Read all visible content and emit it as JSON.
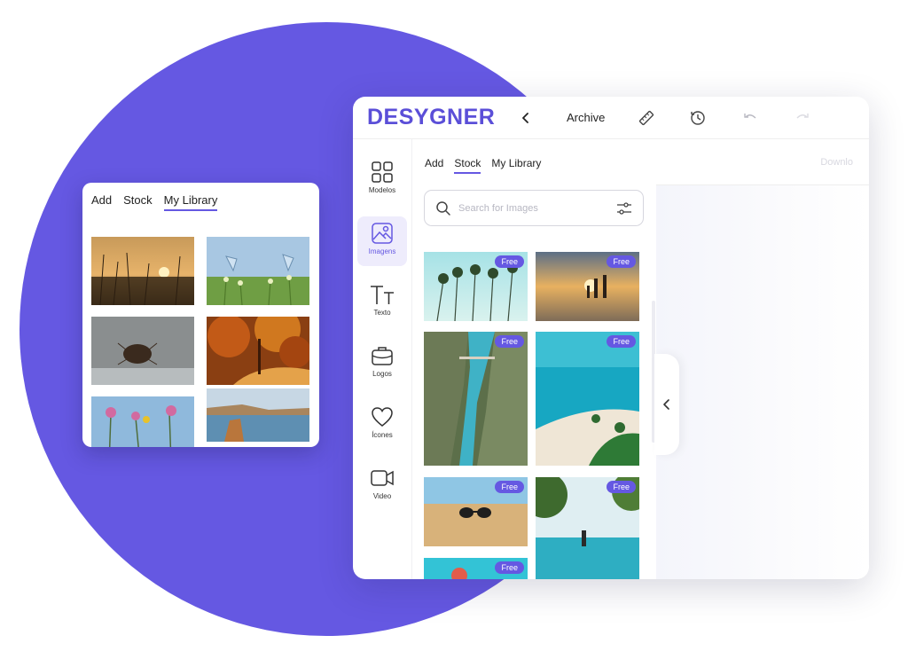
{
  "colors": {
    "accent": "#6558e2",
    "brand": "#5b4fd8",
    "badge_bg": "#6558e2"
  },
  "library_card": {
    "tabs": [
      {
        "label": "Add",
        "active": false
      },
      {
        "label": "Stock",
        "active": false
      },
      {
        "label": "My Library",
        "active": true
      }
    ],
    "images": [
      "sunset-grass",
      "butterflies-flowers",
      "bug-on-water",
      "autumn-forest",
      "pink-flowers-bee",
      "coastal-cliffs"
    ]
  },
  "header": {
    "brand": "DESYGNER",
    "archive_label": "Archive",
    "icons": [
      "back-chevron-icon",
      "ruler-icon",
      "history-icon",
      "undo-icon",
      "redo-icon"
    ]
  },
  "sidebar": {
    "items": [
      {
        "label": "Modelos",
        "icon": "templates-grid-icon",
        "active": false
      },
      {
        "label": "Imagens",
        "icon": "image-icon",
        "active": true
      },
      {
        "label": "Texto",
        "icon": "text-icon",
        "active": false
      },
      {
        "label": "Logos",
        "icon": "briefcase-icon",
        "active": false
      },
      {
        "label": "Ícones",
        "icon": "heart-icon",
        "active": false
      },
      {
        "label": "Video",
        "icon": "video-camera-icon",
        "active": false
      }
    ]
  },
  "panel": {
    "tabs": [
      {
        "label": "Add",
        "active": false
      },
      {
        "label": "Stock",
        "active": true
      },
      {
        "label": "My Library",
        "active": false
      }
    ],
    "search": {
      "placeholder": "Search for Images",
      "value": ""
    },
    "images": [
      {
        "subject": "palm-trees",
        "badge": "Free"
      },
      {
        "subject": "beach-sunset-family",
        "badge": "Free"
      },
      {
        "subject": "canyon-river-bridge",
        "badge": "Free"
      },
      {
        "subject": "tropical-beach-aerial",
        "badge": "Free"
      },
      {
        "subject": "sunglasses-on-sand",
        "badge": "Free"
      },
      {
        "subject": "infinity-pool-woman",
        "badge": "Free"
      },
      {
        "subject": "pool-floaty",
        "badge": "Free"
      }
    ]
  },
  "canvas": {
    "toolbar_label": "Downlo"
  }
}
